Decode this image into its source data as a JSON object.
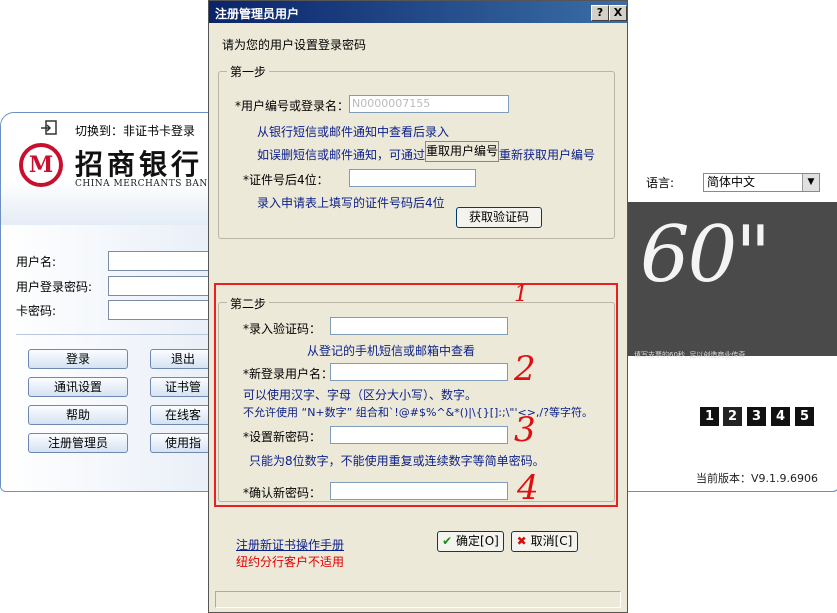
{
  "background_app": {
    "logo_text": "M",
    "bank_name": "招商银行",
    "bank_name_en": "CHINA MERCHANTS BANK",
    "switch_text": "切换到：非证书卡登录",
    "fields": [
      {
        "label": "用户名:"
      },
      {
        "label": "用户登录密码:"
      },
      {
        "label": "卡密码:"
      }
    ],
    "buttons": [
      "登录",
      "退出",
      "通讯设置",
      "证书管",
      "帮助",
      "在线客",
      "注册管理员",
      "使用指"
    ],
    "language_label": "语言:",
    "language_value": "简体中文",
    "banner_big": "60\"",
    "banner_sub": "填写支票的60秒, 足以创造商业传奇",
    "pages": [
      "1",
      "2",
      "3",
      "4",
      "5"
    ],
    "active_page": "2",
    "version": "当前版本：V9.1.9.6906"
  },
  "dialog": {
    "title": "注册管理员用户",
    "help_btn": "?",
    "close_btn": "X",
    "intro": "请为您的用户设置登录密码",
    "step1": {
      "legend": "第一步",
      "user_label": "*用户编号或登录名：",
      "user_value": "N0000007155",
      "hint1": "从银行短信或邮件通知中查看后录入",
      "hint2_pre": "如误删短信或邮件通知，可通过",
      "retrieve_btn": "重取用户编号",
      "hint2_post": "重新获取用户编号",
      "cert_label": "*证件号后4位：",
      "cert_hint": "录入申请表上填写的证件号码后4位",
      "get_code_btn": "获取验证码"
    },
    "step2": {
      "legend": "第二步",
      "code_label": "*录入验证码：",
      "code_hint": "从登记的手机短信或邮箱中查看",
      "newname_label": "*新登录用户名：",
      "newname_hint1": "可以使用汉字、字母（区分大小写）、数字。",
      "newname_hint2": "不允许使用 “N+数字” 组合和`!@#$%^&*()|\\{}[]:;\\\"'<>,/?等字符。",
      "pwd_label": "*设置新密码：",
      "pwd_hint": "只能为8位数字，不能使用重复或连续数字等简单密码。",
      "confirm_label": "*确认新密码："
    },
    "manual_link": "注册新证书操作手册",
    "notice": "纽约分行客户不适用",
    "ok_btn": "确定[O]",
    "cancel_btn": "取消[C]"
  },
  "annotations": [
    "1",
    "2",
    "3",
    "4"
  ],
  "colors": {
    "title_bar": "#0a246a",
    "dialog_bg": "#ece9d8",
    "hint_text": "#0a1e8a",
    "annotation": "#e82020",
    "brand_red": "#c8102e"
  }
}
